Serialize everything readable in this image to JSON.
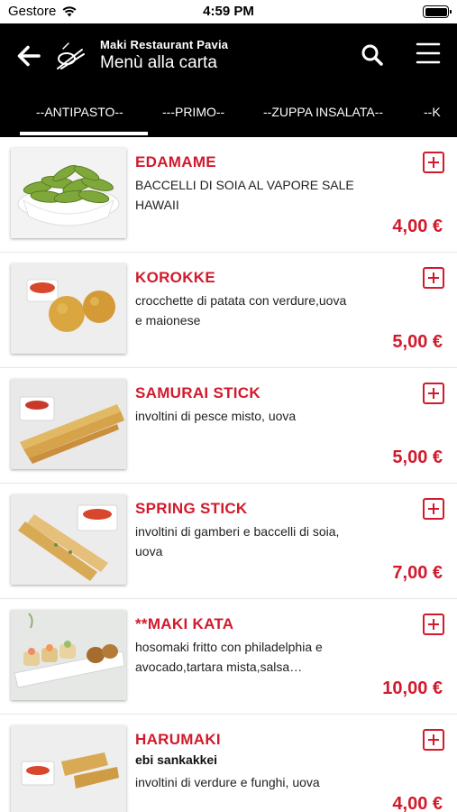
{
  "status": {
    "carrier": "Gestore",
    "time": "4:59 PM"
  },
  "header": {
    "restaurant": "Maki Restaurant Pavia",
    "title": "Menù alla carta",
    "icons": [
      "back-arrow-icon",
      "chopsticks-logo-icon",
      "search-icon",
      "hamburger-menu-icon"
    ]
  },
  "tabs": [
    "--ANTIPASTO--",
    "---PRIMO--",
    "--ZUPPA INSALATA--",
    "--K"
  ],
  "colors": {
    "accent": "#d21a2c",
    "header_bg": "#000000"
  },
  "items": [
    {
      "name": "EDAMAME",
      "desc": "BACCELLI DI SOIA AL VAPORE SALE",
      "desc2": "HAWAII",
      "price": "4,00 €",
      "photo": "edamame-photo"
    },
    {
      "name": "KOROKKE",
      "desc": "crocchette di patata con verdure,uova",
      "desc2": "e maionese",
      "price": "5,00 €",
      "photo": "korokke-photo"
    },
    {
      "name": "SAMURAI STICK",
      "desc": "involtini di pesce misto, uova",
      "desc2": "",
      "price": "5,00 €",
      "photo": "samurai-stick-photo"
    },
    {
      "name": "SPRING STICK",
      "desc": "involtini di gamberi e baccelli di soia,",
      "desc2": "uova",
      "price": "7,00 €",
      "photo": "spring-stick-photo"
    },
    {
      "name": "**MAKI KATA",
      "desc": "hosomaki fritto con philadelphia e",
      "desc2": "avocado,tartara mista,salsa…",
      "price": "10,00 €",
      "photo": "maki-kata-photo"
    },
    {
      "name": "HARUMAKI",
      "sub": "ebi sankakkei",
      "desc": "involtini di verdure e funghi, uova",
      "price": "4,00 €",
      "photo": "harumaki-photo"
    }
  ]
}
